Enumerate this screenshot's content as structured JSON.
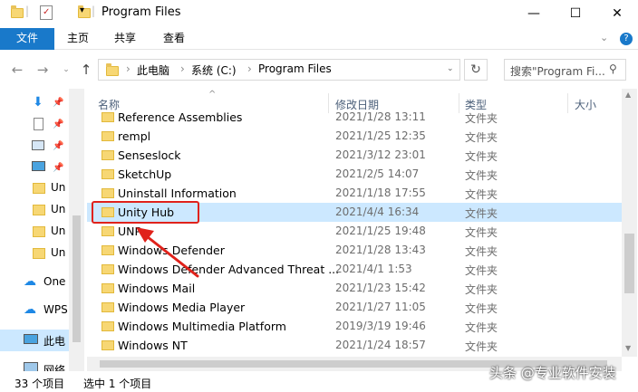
{
  "window": {
    "title": "Program Files",
    "controls": [
      "minimize",
      "maximize",
      "close"
    ]
  },
  "ribbon": {
    "tabs": [
      {
        "label": "文件",
        "active": true
      },
      {
        "label": "主页"
      },
      {
        "label": "共享"
      },
      {
        "label": "查看"
      }
    ]
  },
  "address": {
    "crumbs": [
      "此电脑",
      "系统 (C:)",
      "Program Files"
    ]
  },
  "search": {
    "placeholder": "搜索\"Program Fi..."
  },
  "nav_pane": {
    "items": [
      {
        "label": "",
        "icon": "download-icon"
      },
      {
        "label": "",
        "icon": "document-icon"
      },
      {
        "label": "",
        "icon": "picture-icon"
      },
      {
        "label": "",
        "icon": "desktop-icon"
      },
      {
        "label": "Un",
        "icon": "folder-icon"
      },
      {
        "label": "Un",
        "icon": "folder-icon"
      },
      {
        "label": "Un",
        "icon": "folder-icon"
      },
      {
        "label": "Un",
        "icon": "folder-icon"
      },
      {
        "label": "One",
        "icon": "cloud-icon"
      },
      {
        "label": "WPS",
        "icon": "cloud-icon"
      },
      {
        "label": "此电",
        "icon": "computer-icon"
      },
      {
        "label": "网络",
        "icon": "network-icon"
      }
    ]
  },
  "columns": {
    "name": "名称",
    "modified": "修改日期",
    "type": "类型",
    "size": "大小"
  },
  "files": [
    {
      "name": "Reference Assemblies",
      "date": "2021/1/28 13:11",
      "type": "文件夹"
    },
    {
      "name": "rempl",
      "date": "2021/1/25 12:35",
      "type": "文件夹"
    },
    {
      "name": "Senseslock",
      "date": "2021/3/12 23:01",
      "type": "文件夹"
    },
    {
      "name": "SketchUp",
      "date": "2021/2/5 14:07",
      "type": "文件夹"
    },
    {
      "name": "Uninstall Information",
      "date": "2021/1/18 17:55",
      "type": "文件夹"
    },
    {
      "name": "Unity Hub",
      "date": "2021/4/4 16:34",
      "type": "文件夹",
      "selected": true
    },
    {
      "name": "UNP",
      "date": "2021/1/25 19:48",
      "type": "文件夹"
    },
    {
      "name": "Windows Defender",
      "date": "2021/1/28 13:43",
      "type": "文件夹"
    },
    {
      "name": "Windows Defender Advanced Threat ...",
      "date": "2021/4/1 1:53",
      "type": "文件夹"
    },
    {
      "name": "Windows Mail",
      "date": "2021/1/23 15:42",
      "type": "文件夹"
    },
    {
      "name": "Windows Media Player",
      "date": "2021/1/27 11:05",
      "type": "文件夹"
    },
    {
      "name": "Windows Multimedia Platform",
      "date": "2019/3/19 19:46",
      "type": "文件夹"
    },
    {
      "name": "Windows NT",
      "date": "2021/1/24 18:57",
      "type": "文件夹"
    }
  ],
  "status": {
    "count": "33 个项目",
    "selected": "选中 1 个项目"
  },
  "watermark": "头条 @专业软件安装",
  "colors": {
    "accent": "#1979ca",
    "selection": "#cce8ff",
    "annotation": "#e0221b"
  }
}
